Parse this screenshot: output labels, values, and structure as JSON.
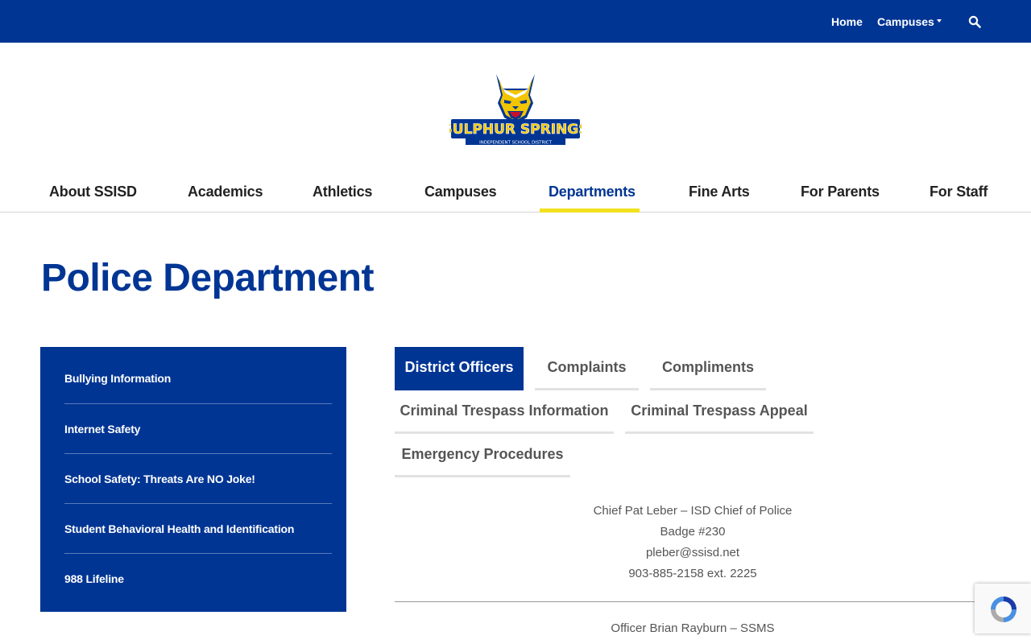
{
  "topbar": {
    "home_label": "Home",
    "campuses_label": "Campuses",
    "bg_color": "#003594"
  },
  "logo": {
    "text": "SULPHUR SPRINGS",
    "subtext": "INDEPENDENT SCHOOL DISTRICT"
  },
  "main_nav": {
    "items": [
      {
        "label": "About SSISD"
      },
      {
        "label": "Academics"
      },
      {
        "label": "Athletics"
      },
      {
        "label": "Campuses"
      },
      {
        "label": "Departments",
        "active": true
      },
      {
        "label": "Fine Arts"
      },
      {
        "label": "For Parents"
      },
      {
        "label": "For Staff"
      }
    ],
    "active_underline_color": "#f2e11e"
  },
  "page": {
    "title": "Police Department",
    "accent_color": "#003594"
  },
  "sidebar": {
    "items": [
      {
        "label": "Bullying Information"
      },
      {
        "label": "Internet Safety"
      },
      {
        "label": "School Safety: Threats Are NO Joke!"
      },
      {
        "label": "Student Behavioral Health and Identification"
      },
      {
        "label": "988 Lifeline"
      }
    ]
  },
  "tabs": [
    {
      "label": "District Officers",
      "active": true
    },
    {
      "label": "Complaints"
    },
    {
      "label": "Compliments"
    },
    {
      "label": "Criminal Trespass Information"
    },
    {
      "label": "Criminal Trespass Appeal"
    },
    {
      "label": "Emergency Procedures"
    }
  ],
  "officers": [
    {
      "name": "Chief Pat Leber – ISD Chief of Police",
      "badge": "Badge #230",
      "email": "pleber@ssisd.net",
      "phone": "903-885-2158 ext. 2225"
    },
    {
      "name": "Officer Brian Rayburn – SSMS"
    }
  ]
}
